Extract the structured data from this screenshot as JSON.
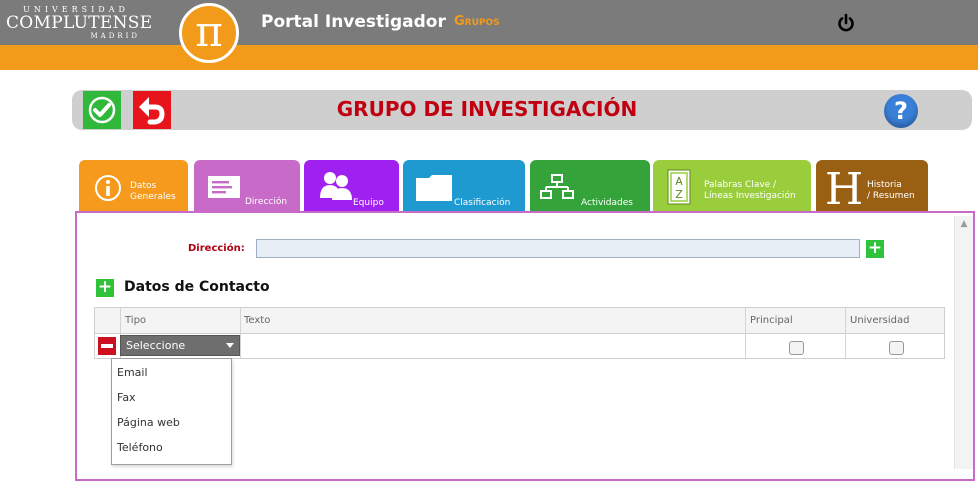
{
  "topbar": {
    "university": {
      "line1": "UNIVERSIDAD",
      "line2": "COMPLUTENSE",
      "line3": "MADRID"
    },
    "pi_symbol": "π",
    "app_title": "Portal Investigador",
    "section_link": "Grupos",
    "logout_icon": "power-icon"
  },
  "header": {
    "title": "GRUPO DE INVESTIGACIÓN",
    "save_icon": "check-icon",
    "back_icon": "undo-arrow-icon",
    "help_symbol": "?"
  },
  "tabs": [
    {
      "line1": "Datos",
      "line2": "Generales",
      "icon": "info-icon",
      "color": "#f59a1c"
    },
    {
      "line1": "Dirección",
      "line2": "",
      "icon": "address-card-icon",
      "color": "#c86bc8"
    },
    {
      "line1": "Equipo",
      "line2": "",
      "icon": "users-icon",
      "color": "#a020f0"
    },
    {
      "line1": "Clasificación",
      "line2": "",
      "icon": "folder-icon",
      "color": "#1e9ad0"
    },
    {
      "line1": "Actividades",
      "line2": "",
      "icon": "hierarchy-icon",
      "color": "#33a33a"
    },
    {
      "line1": "Palabras Clave /",
      "line2": "Líneas Investigación",
      "icon": "dictionary-icon",
      "color": "#9acd3c"
    },
    {
      "line1": "Historia",
      "line2": "/ Resumen",
      "icon": "letter-h-icon",
      "color": "#996014"
    }
  ],
  "active_tab": "Dirección",
  "form": {
    "direccion_label": "Dirección:",
    "direccion_value": "",
    "add_symbol": "+",
    "contact_section_title": "Datos de Contacto"
  },
  "contact_table": {
    "columns": [
      "Tipo",
      "Texto",
      "Principal",
      "Universidad"
    ],
    "rows": [
      {
        "tipo": "Seleccione",
        "texto": "",
        "principal": false,
        "universidad": false
      }
    ]
  },
  "tipo_dropdown": {
    "options": [
      "Email",
      "Fax",
      "Página web",
      "Teléfono"
    ]
  }
}
